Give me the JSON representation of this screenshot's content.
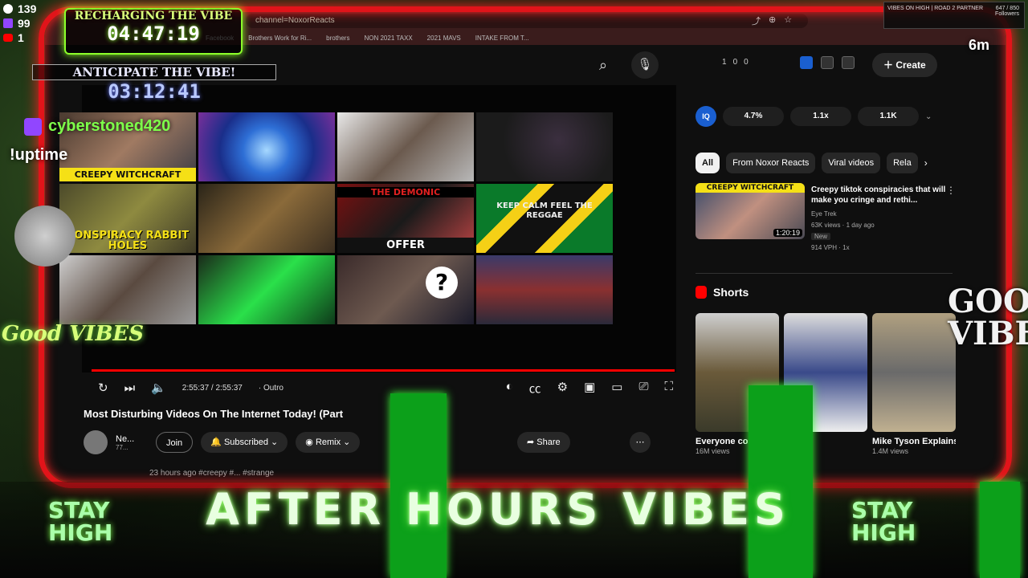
{
  "browser": {
    "url": "channel=NoxorReacts",
    "bookmarks": [
      "Facebook",
      "Brothers Work for Ri...",
      "brothers",
      "NON 2021 TAXX",
      "2021 MAVS",
      "INTAKE FROM T..."
    ]
  },
  "header": {
    "create_label": "Create",
    "stats": [
      "1",
      "0",
      "0"
    ]
  },
  "player": {
    "grid_thumbs": [
      {
        "caption": "CREEPY WITCHCRAFT",
        "top_caption": ""
      },
      {
        "caption": "",
        "top_caption": ""
      },
      {
        "caption": "",
        "top_caption": ""
      },
      {
        "caption": "",
        "top_caption": ""
      },
      {
        "caption": "CONSPIRACY RABBIT HOLES",
        "top_caption": ""
      },
      {
        "caption": "",
        "top_caption": ""
      },
      {
        "caption": "OFFER",
        "top_caption": "THE DEMONIC"
      },
      {
        "caption": "KEEP CALM FEEL THE REGGAE",
        "top_caption": ""
      },
      {
        "caption": "",
        "top_caption": ""
      },
      {
        "caption": "",
        "top_caption": ""
      },
      {
        "caption": "",
        "top_caption": "?"
      },
      {
        "caption": "",
        "top_caption": ""
      }
    ],
    "time": "2:55:37 / 2:55:37",
    "chapter": "· Outro",
    "progress": 1.0
  },
  "video": {
    "title": "Most Disturbing Videos On The Internet Today! (Part",
    "channel": "Ne...",
    "subs": "77...",
    "join_label": "Join",
    "subscribe_label": "Subscribed",
    "remix_label": "Remix",
    "share_label": "Share",
    "upload": "23 hours ago #creepy #... #strange"
  },
  "extension": {
    "iq": "IQ",
    "stats": [
      "4.7%",
      "1.1x",
      "1.1K"
    ]
  },
  "chips": [
    "All",
    "From Noxor Reacts",
    "Viral videos",
    "Rela"
  ],
  "recommendation": {
    "caption": "CREEPY WITCHCRAFT",
    "duration": "1:20:19",
    "title": "Creepy tiktok conspiracies that will make you cringe and rethi...",
    "channel": "Eye Trek",
    "views": "63K views · 1 day ago",
    "badge": "New",
    "vph": "914 VPH  ·  1x"
  },
  "shorts": {
    "heading": "Shorts",
    "items": [
      {
        "title": "Everyone couldn't...",
        "views": "16M views"
      },
      {
        "title": "",
        "views": ""
      },
      {
        "title": "Mike Tyson Explains W...",
        "views": "1.4M views"
      }
    ]
  },
  "overlay": {
    "counts": {
      "twitch": "139",
      "kick": "99",
      "youtube": "1"
    },
    "recharge_label": "RECHARGING THE VIBE",
    "recharge_time": "04:47:19",
    "anticipate_label": "ANTICIPATE THE VIBE!",
    "anticipate_time": "03:12:41",
    "username": "cyberstoned420",
    "command": "!uptime",
    "panel_title": "VIBES ON HIGH | ROAD 2 PARTNER",
    "panel_count": "647 / 850",
    "panel_sub": "Followers",
    "timer_6m": "6m",
    "good_vibes_left": "Good VIBES",
    "good_vibes_right": "GOOD VIBES",
    "after_hours": "AFTER HOURS VIBES",
    "stay_high": "STAY HIGH"
  },
  "colors": {
    "frame": "#e1141a",
    "accent_green": "#7dff4a",
    "youtube_red": "#ff0000"
  }
}
